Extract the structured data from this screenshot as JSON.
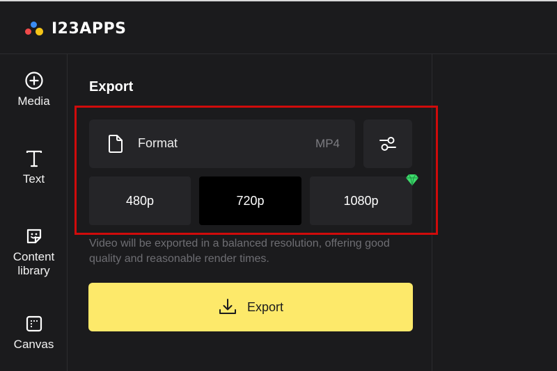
{
  "app": {
    "logo_text": "I23APPS",
    "logo_dot_colors": [
      "#f04a4a",
      "#3a8cf2",
      "#f5c518"
    ]
  },
  "sidebar": {
    "items": [
      {
        "label": "Media",
        "icon": "plus-circle-icon"
      },
      {
        "label": "Text",
        "icon": "text-t-icon"
      },
      {
        "label": "Content\nlibrary",
        "icon": "sticker-icon"
      },
      {
        "label": "Canvas",
        "icon": "canvas-grid-icon"
      }
    ]
  },
  "export_panel": {
    "title": "Export",
    "format": {
      "label": "Format",
      "value": "MP4",
      "icon": "file-icon"
    },
    "settings_icon": "sliders-icon",
    "resolutions": [
      {
        "label": "480p",
        "selected": false
      },
      {
        "label": "720p",
        "selected": true
      },
      {
        "label": "1080p",
        "selected": false,
        "premium": true
      }
    ],
    "premium_icon": "gem-icon",
    "description": "Video will be exported in a balanced resolution, offering good quality and reasonable render times.",
    "export_button": {
      "label": "Export",
      "icon": "download-icon"
    }
  },
  "colors": {
    "accent_yellow": "#fde96a",
    "highlight_red": "#d00b0b",
    "premium_green": "#3ddc6b"
  }
}
